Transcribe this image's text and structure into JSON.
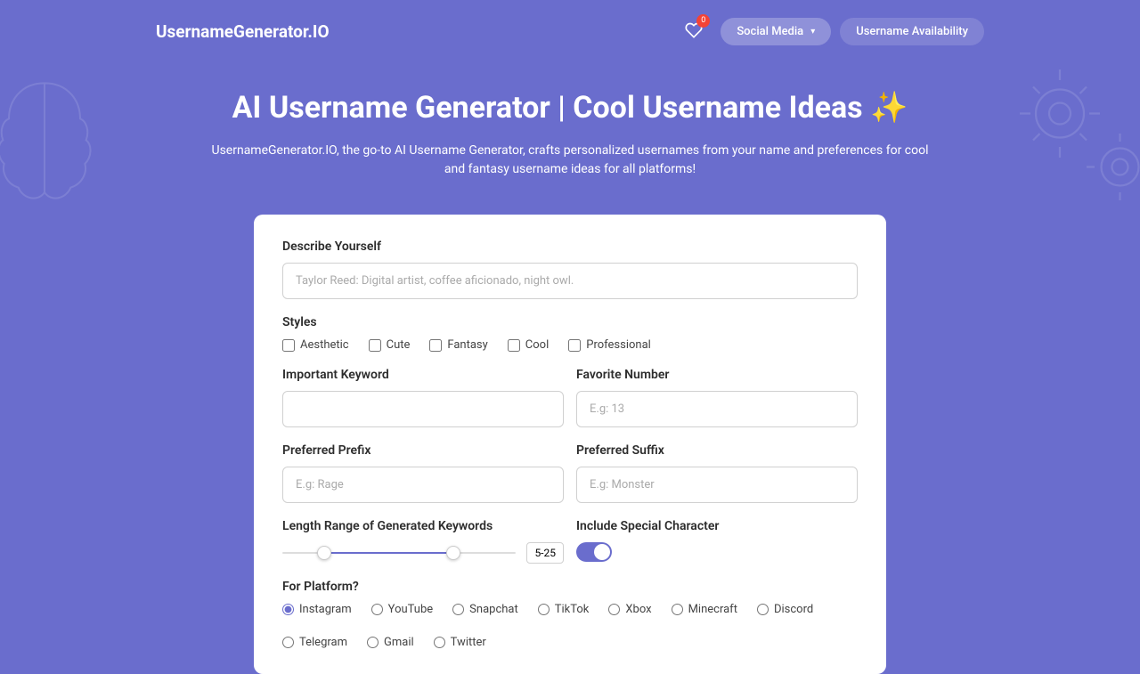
{
  "logo": "UsernameGenerator.IO",
  "nav": {
    "fav_count": "0",
    "social_media": "Social Media",
    "availability": "Username Availability"
  },
  "hero": {
    "title": "AI Username Generator | Cool Username Ideas ✨",
    "subtitle": "UsernameGenerator.IO, the go-to AI Username Generator, crafts personalized usernames from your name and preferences for cool and fantasy username ideas for all platforms!"
  },
  "form": {
    "describe_label": "Describe Yourself",
    "describe_placeholder": "Taylor Reed: Digital artist, coffee aficionado, night owl.",
    "styles_label": "Styles",
    "styles": [
      "Aesthetic",
      "Cute",
      "Fantasy",
      "Cool",
      "Professional"
    ],
    "keyword_label": "Important Keyword",
    "number_label": "Favorite Number",
    "number_placeholder": "E.g: 13",
    "prefix_label": "Preferred Prefix",
    "prefix_placeholder": "E.g: Rage",
    "suffix_label": "Preferred Suffix",
    "suffix_placeholder": "E.g: Monster",
    "length_label": "Length Range of Generated Keywords",
    "length_value": "5-25",
    "special_label": "Include Special Character",
    "platform_label": "For Platform?",
    "platforms": [
      "Instagram",
      "YouTube",
      "Snapchat",
      "TikTok",
      "Xbox",
      "Minecraft",
      "Discord",
      "Telegram",
      "Gmail",
      "Twitter"
    ],
    "platform_selected": "Instagram"
  }
}
